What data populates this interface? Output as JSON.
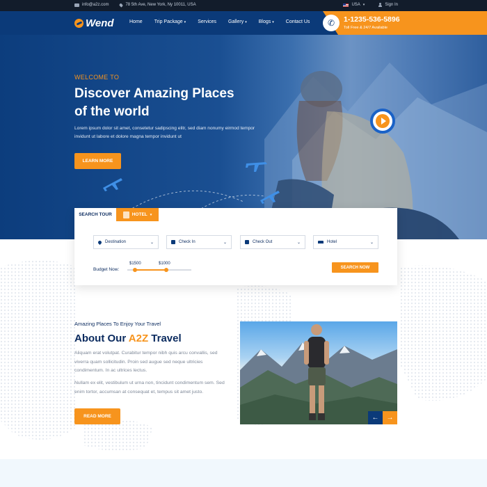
{
  "topbar": {
    "email": "info@a2z.com",
    "address": "78 5th Ave, New York, Ny 10011, USA",
    "language": "USA",
    "signin": "Sign In"
  },
  "header": {
    "logo": "Wend",
    "nav": [
      {
        "label": "Home",
        "has_caret": false
      },
      {
        "label": "Trip Package",
        "has_caret": true
      },
      {
        "label": "Services",
        "has_caret": false
      },
      {
        "label": "Gallery",
        "has_caret": true
      },
      {
        "label": "Blogs",
        "has_caret": true
      },
      {
        "label": "Contact Us",
        "has_caret": false
      }
    ],
    "phone": "1-1235-536-5896",
    "phone_sub": "Toll Free & 24/7 Available"
  },
  "hero": {
    "welcome": "WELCOME TO",
    "title_line1": "Discover Amazing Places",
    "title_line2": "of the world",
    "desc": "Lorem ipsum dolor sit amet, consetetur sadipscing elitr, sed diam nonumy eirmod tempor invidunt ut labore et dolore magna tempor invidunt ut",
    "button": "LEARN MORE"
  },
  "search": {
    "tab_tour": "SEARCH TOUR",
    "tab_hotel": "HOTEL",
    "fields": [
      "Destination",
      "Check In",
      "Check Out",
      "Hotel"
    ],
    "budget_label": "Budget Now:",
    "budget_min": "$1500",
    "budget_max": "$1000",
    "button": "SEARCH NOW"
  },
  "about": {
    "subtitle": "Amazing Places To Enjoy Your Travel",
    "title_pre": "About Our ",
    "title_hl": "A2Z",
    "title_post": " Travel",
    "p1": "Aliquam erat volutpat. Curabitur tempor nibh quis arcu convallis, sed viverra quam sollicitudin. Proin sed augue sed neque ultricies condimentum. In ac ultrices lectus.",
    "p2": "Nullam ex elit, vestibulum ut urna non, tincidunt condimentum sem. Sed enim tortor, accumsan at consequat et, tempus sit amet justo.",
    "button": "READ MORE"
  },
  "colors": {
    "primary": "#0b3a79",
    "accent": "#f7941d"
  }
}
